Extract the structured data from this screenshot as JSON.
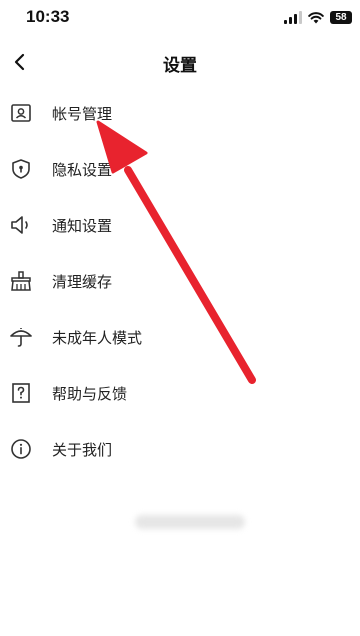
{
  "status_bar": {
    "time": "10:33",
    "battery": "58"
  },
  "nav": {
    "title": "设置"
  },
  "menu": {
    "items": [
      {
        "label": "帐号管理",
        "icon": "account-card-icon"
      },
      {
        "label": "隐私设置",
        "icon": "privacy-shield-icon"
      },
      {
        "label": "通知设置",
        "icon": "speaker-icon"
      },
      {
        "label": "清理缓存",
        "icon": "broom-icon"
      },
      {
        "label": "未成年人模式",
        "icon": "umbrella-icon"
      },
      {
        "label": "帮助与反馈",
        "icon": "help-question-icon"
      },
      {
        "label": "关于我们",
        "icon": "info-icon"
      }
    ]
  },
  "colors": {
    "annotation_arrow": "#e8232e"
  }
}
